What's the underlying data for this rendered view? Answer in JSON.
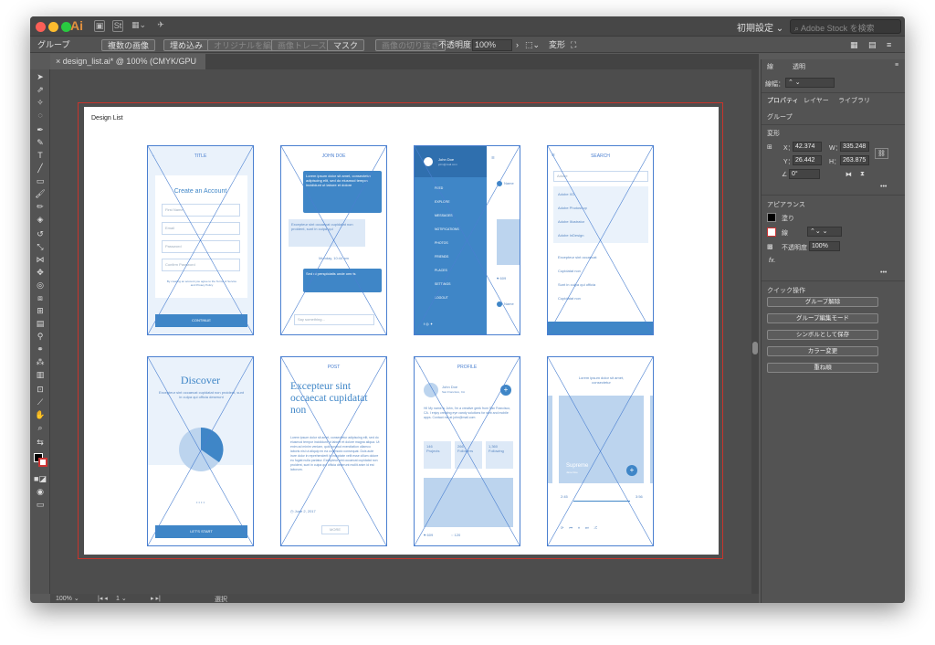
{
  "app": {
    "icon": "Ai",
    "document_tab": "design_list.ai* @ 100% (CMYK/GPU プレビュー)",
    "workspace": "初期設定",
    "stock_search_placeholder": "Adobe Stock を検索"
  },
  "control_bar": {
    "selection_type": "グループ",
    "btn_multi_image": "複数の画像",
    "btn_embed": "埋め込み",
    "btn_edit_original": "オリジナルを編集",
    "btn_image_trace": "画像トレース",
    "btn_mask": "マスク",
    "btn_crop_image": "画像の切り抜き",
    "opacity_label": "不透明度：",
    "opacity_value": "100%",
    "transform_label": "変形"
  },
  "artboard": {
    "label": "Design List"
  },
  "screens": {
    "s1": {
      "title": "TITLE",
      "heading": "Create an Account",
      "fields": [
        "First Name",
        "Email",
        "Password",
        "Confirm Password"
      ],
      "terms": "By creating an account you agree to the Terms of Service and Privacy Policy",
      "button": "CONTINUE"
    },
    "s2": {
      "title": "JOHN DOE",
      "bubble1": "Lorem ipsum dolor sit amet, consectetur adipiscing elit, sed do eiusmod tempor incididunt ut labore et dolore",
      "bubble2": "Excepteur sint occaecat cupidatat non proident, sunt in culpa qui",
      "date": "Monday, 10:44 am",
      "bubble3": "Sed ut perspiciatis unde omnis",
      "input": "Say something..."
    },
    "s3": {
      "name": "John Doe",
      "email": "john@mail.com",
      "menu": [
        "FEED",
        "EXPLORE",
        "MESSAGES",
        "NOTIFICATIONS",
        "PHOTOS",
        "FRIENDS",
        "PLACES",
        "SETTINGS",
        "LOGOUT"
      ],
      "side_name": "Name",
      "likes": "609"
    },
    "s4": {
      "title": "SEARCH",
      "query": "Adobe",
      "results": [
        "Adobe XD",
        "Adobe Photoshop",
        "Adobe Illustrator",
        "Adobe InDesign"
      ],
      "recent": [
        "Excepteur sint occaecat",
        "Cupidatat non",
        "Sunt in culpa qui officia",
        "Cupidatat non"
      ]
    },
    "s5": {
      "heading": "Discover",
      "text": "Excepteur sint occaecat cupidatat non proident, sunt in culpa qui officia deserunt",
      "button": "LET'S START"
    },
    "s6": {
      "title": "POST",
      "heading": "Excepteur sint occaecat cupidatat non",
      "body": "Lorem ipsum dolor sit amet, consectetur adipiscing elit, sed do eiusmod tempor incididunt ut labore et dolore magna aliqua. Ut enim ad minim veniam, quis nostrud exercitation ullamco laboris nisi ut aliquip ex ea commodo consequat. Duis aute irure dolor in reprehenderit in voluptate velit esse cillum dolore eu fugiat nulla pariatur. Excepteur sint occaecat cupidatat non proident, sunt in culpa qui officia deserunt mollit anim id est laborum.",
      "date": "June 2, 2017",
      "button": "MORE"
    },
    "s7": {
      "title": "PROFILE",
      "name": "John Doe",
      "location": "San Francisco, CA",
      "bio": "Hi! My name is John, I'm a creative geek from San Francisco, CA. I enjoy creating eye candy solutions for web and mobile apps. Contact me at john@mail.com",
      "stats": [
        {
          "n": "146",
          "l": "Projects"
        },
        {
          "n": "266",
          "l": "Followers"
        },
        {
          "n": "1,360",
          "l": "Following"
        }
      ],
      "likes": "609",
      "comments": "120"
    },
    "s8": {
      "text": "Lorem ipsum dolor sit amet, consectetur",
      "track": "Supreme",
      "artist": "Jane Doe",
      "t_start": "2:45",
      "t_end": "3:56"
    }
  },
  "status_bar": {
    "zoom": "100%",
    "artboard_num": "1",
    "mode": "選択"
  },
  "right_panel": {
    "tabs_top": [
      "線",
      "透明"
    ],
    "stroke_width_label": "線幅：",
    "tabs": [
      "プロパティ",
      "レイヤー",
      "ライブラリ"
    ],
    "group_label": "グループ",
    "transform_title": "変形",
    "x_label": "X：",
    "x": "42.374",
    "y_label": "Y：",
    "y": "26.442",
    "w_label": "W：",
    "w": "335.248",
    "h_label": "H：",
    "h": "263.875",
    "angle": "0°",
    "appearance_title": "アピアランス",
    "fill": "塗り",
    "stroke": "線",
    "opacity_label": "不透明度",
    "opacity": "100%",
    "fx": "fx.",
    "quick_title": "クイック操作",
    "quick_actions": [
      "グループ解除",
      "グループ編集モード",
      "シンボルとして保存",
      "カラー変更",
      "重ね順"
    ]
  },
  "colors": {
    "accent": "#3f86c7",
    "wire": "#4a7fd0",
    "artboard_border": "#c8342c",
    "app_icon": "#e0913f"
  }
}
